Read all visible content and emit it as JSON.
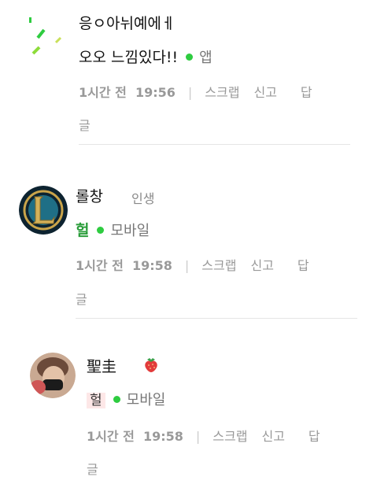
{
  "colors": {
    "accent_green": "#2ecc40",
    "divider": "#e5e5e5",
    "meta_gray": "#999999"
  },
  "comments": [
    {
      "nickname": "응ㅇ아뉘예에ㅔ",
      "text": "오오 느낌있다!!",
      "device": "앱",
      "time": "1시간 전",
      "time_clock": "19:56",
      "actions": [
        "스크랩",
        "신고",
        "답",
        "글"
      ]
    },
    {
      "nickname": "롤창",
      "tag": "인생",
      "text": "헐",
      "device": "모바일",
      "time": "1시간 전",
      "time_clock": "19:58",
      "actions": [
        "스크랩",
        "신고",
        "답",
        "글"
      ]
    },
    {
      "nickname": "聖圭",
      "badge_icon": "strawberry-icon",
      "text": "헐",
      "device": "모바일",
      "time": "1시간 전",
      "time_clock": "19:58",
      "actions": [
        "스크랩",
        "신고",
        "답",
        "글"
      ]
    }
  ]
}
